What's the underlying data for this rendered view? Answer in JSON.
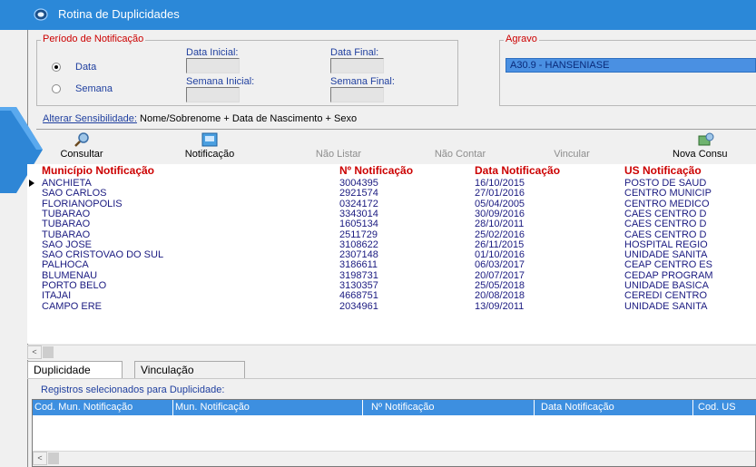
{
  "window": {
    "title": "Rotina de Duplicidades"
  },
  "periodo": {
    "legend": "Período de Notificação",
    "data_inicial_label": "Data Inicial:",
    "data_final_label": "Data Final:",
    "semana_inicial_label": "Semana Inicial:",
    "semana_final_label": "Semana Final:",
    "radio_data_label": "Data",
    "radio_semana_label": "Semana",
    "selected": "Data"
  },
  "agravo": {
    "legend": "Agravo",
    "value": "A30.9 - HANSENIASE"
  },
  "sensibilidade": {
    "link": "Alterar Sensibilidade:",
    "value": "Nome/Sobrenome + Data de Nascimento + Sexo"
  },
  "toolbar": {
    "consultar": "Consultar",
    "notificacao": "Notificação",
    "nao_listar": "Não Listar",
    "nao_contar": "Não Contar",
    "vincular": "Vincular",
    "nova_consulta": "Nova Consu"
  },
  "grid": {
    "headers": [
      "Município Notificação",
      "Nº Notificação",
      "Data Notificação",
      "US Notificação"
    ],
    "rows": [
      [
        "ANCHIETA",
        "3004395",
        "16/10/2015",
        "POSTO DE SAUD"
      ],
      [
        "SAO CARLOS",
        "2921574",
        "27/01/2016",
        "CENTRO MUNICIP"
      ],
      [
        "FLORIANOPOLIS",
        "0324172",
        "05/04/2005",
        "CENTRO MEDICO"
      ],
      [
        "TUBARAO",
        "3343014",
        "30/09/2016",
        "CAES CENTRO D"
      ],
      [
        "TUBARAO",
        "1605134",
        "28/10/2011",
        "CAES CENTRO D"
      ],
      [
        "TUBARAO",
        "2511729",
        "25/02/2016",
        "CAES CENTRO D"
      ],
      [
        "SAO JOSE",
        "3108622",
        "26/11/2015",
        "HOSPITAL REGIO"
      ],
      [
        "SAO CRISTOVAO DO SUL",
        "2307148",
        "01/10/2016",
        "UNIDADE SANITA"
      ],
      [
        "PALHOCA",
        "3186611",
        "06/03/2017",
        "CEAP CENTRO ES"
      ],
      [
        "BLUMENAU",
        "3198731",
        "20/07/2017",
        "CEDAP PROGRAM"
      ],
      [
        "PORTO BELO",
        "3130357",
        "25/05/2018",
        "UNIDADE BASICA"
      ],
      [
        "ITAJAI",
        "4668751",
        "20/08/2018",
        "CEREDI CENTRO"
      ],
      [
        "CAMPO ERE",
        "2034961",
        "13/09/2011",
        "UNIDADE SANITA"
      ]
    ]
  },
  "tabs": [
    "Duplicidade",
    "Vinculação"
  ],
  "duplicidade": {
    "caption": "Registros selecionados para Duplicidade:",
    "headers": [
      "Cod. Mun. Notificação",
      "Mun. Notificação",
      "Nº Notificação",
      "Data Notificação",
      "Cod. US"
    ]
  },
  "colors": {
    "titlebar": "#2b88d8",
    "legend_red": "#cc0000",
    "row_text": "#1a1a80",
    "selection_blue": "#3d8fe0"
  },
  "icons": [
    "app-icon",
    "magnifier-icon",
    "notification-book-icon",
    "new-query-icon",
    "row-pointer-icon",
    "blue-arrow-icon"
  ]
}
